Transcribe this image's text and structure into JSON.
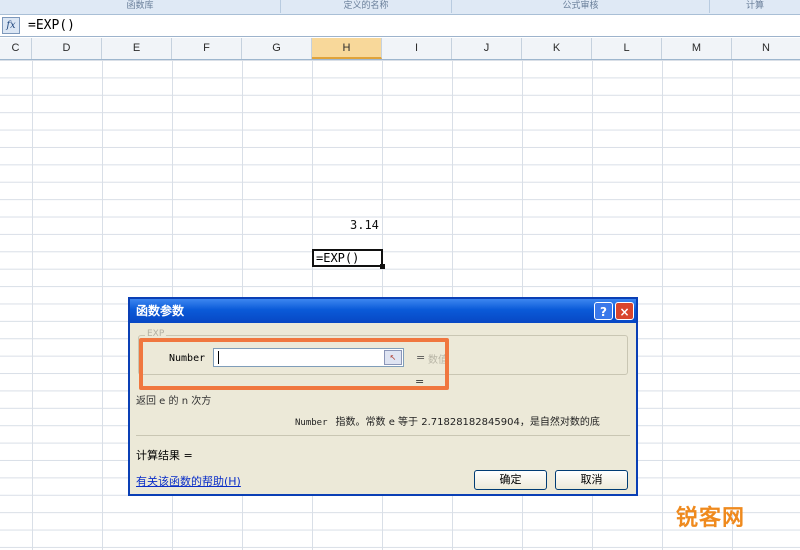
{
  "ribbon": {
    "groups": [
      "函数库",
      "定义的名称",
      "公式审核",
      "计算"
    ]
  },
  "formula_bar": {
    "fx_label": "fx",
    "formula": "=EXP()"
  },
  "grid": {
    "columns": [
      "C",
      "D",
      "E",
      "F",
      "G",
      "H",
      "I",
      "J",
      "K",
      "L",
      "M",
      "N"
    ],
    "active_column": "H",
    "cells": {
      "h_value": "3.14",
      "active_cell_text": "=EXP()"
    }
  },
  "dialog": {
    "title": "函数参数",
    "help_button": "?",
    "close_button": "×",
    "group_legend": "EXP",
    "param_label": "Number",
    "param_value": "",
    "collapse_icon": "↖",
    "equals": "=",
    "param_hint": "数值",
    "equals_result": "=",
    "description": "返回 e 的 n 次方",
    "param_name": "Number",
    "param_description": "指数。常数 e 等于 2.71828182845904，是自然对数的底",
    "calc_result_label": "计算结果 =",
    "help_link": "有关该函数的帮助(H)",
    "ok_label": "确定",
    "cancel_label": "取消"
  },
  "watermark": {
    "text": "锐客网"
  },
  "colors": {
    "highlight": "#f0773f",
    "title_bar": "#0a5ad8",
    "active_column": "#f8d89a"
  }
}
